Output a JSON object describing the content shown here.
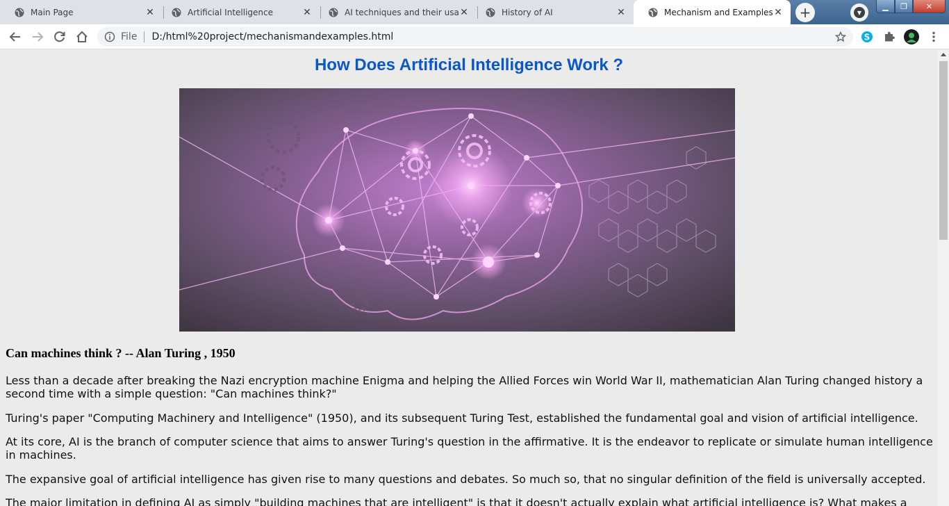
{
  "browser": {
    "tabs": [
      {
        "title": "Main Page",
        "active": false
      },
      {
        "title": "Artificial Intelligence",
        "active": false
      },
      {
        "title": "AI techniques and their usage",
        "active": false
      },
      {
        "title": "History of AI",
        "active": false
      },
      {
        "title": "Mechanism and Examples",
        "active": true
      }
    ],
    "address": {
      "scheme_label": "File",
      "url": "D:/html%20project/mechanismandexamples.html"
    }
  },
  "page": {
    "title": "How Does Artificial Intelligence Work ?",
    "quote_heading": "Can machines think ? -- Alan Turing , 1950",
    "paragraphs": [
      "Less than a decade after breaking the Nazi encryption machine Enigma and helping the Allied Forces win World War II, mathematician Alan Turing changed history a second time with a simple question: \"Can machines think?\"",
      "Turing's paper \"Computing Machinery and Intelligence\" (1950), and its subsequent Turing Test, established the fundamental goal and vision of artificial intelligence.",
      "At its core, AI is the branch of computer science that aims to answer Turing's question in the affirmative. It is the endeavor to replicate or simulate human intelligence in machines.",
      "The expansive goal of artificial intelligence has given rise to many questions and debates. So much so, that no singular definition of the field is universally accepted.",
      "The major limitation in defining AI as simply \"building machines that are intelligent\" is that it doesn't actually explain what artificial intelligence is? What makes a"
    ]
  },
  "colors": {
    "title": "#0b57c9",
    "background": "#ebebeb",
    "hero_glow": "#f3a6f0"
  }
}
